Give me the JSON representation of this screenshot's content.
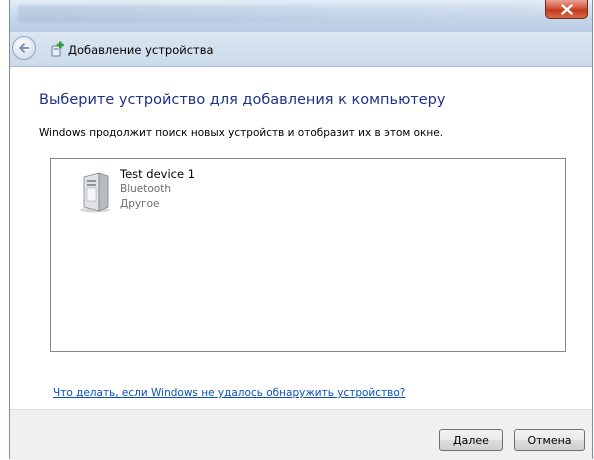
{
  "window": {
    "close_icon": "close-icon"
  },
  "nav": {
    "back_icon": "back-arrow-icon",
    "wizard_icon": "add-device-icon",
    "title": "Добавление устройства"
  },
  "main": {
    "heading": "Выберите устройство для добавления к компьютеру",
    "info": "Windows продолжит поиск новых устройств и отобразит их в этом окне.",
    "devices": [
      {
        "name": "Test device 1",
        "connection": "Bluetooth",
        "category": "Другое",
        "icon": "pc-tower-icon"
      }
    ],
    "help_link": "Что делать, если Windows не удалось обнаружить устройство?"
  },
  "footer": {
    "next_label_accel": "Д",
    "next_label_rest": "алее",
    "cancel_label": "Отмена"
  },
  "colors": {
    "heading": "#1e3287",
    "link": "#0b4fbf",
    "secondary_text": "#6d6d6d"
  }
}
